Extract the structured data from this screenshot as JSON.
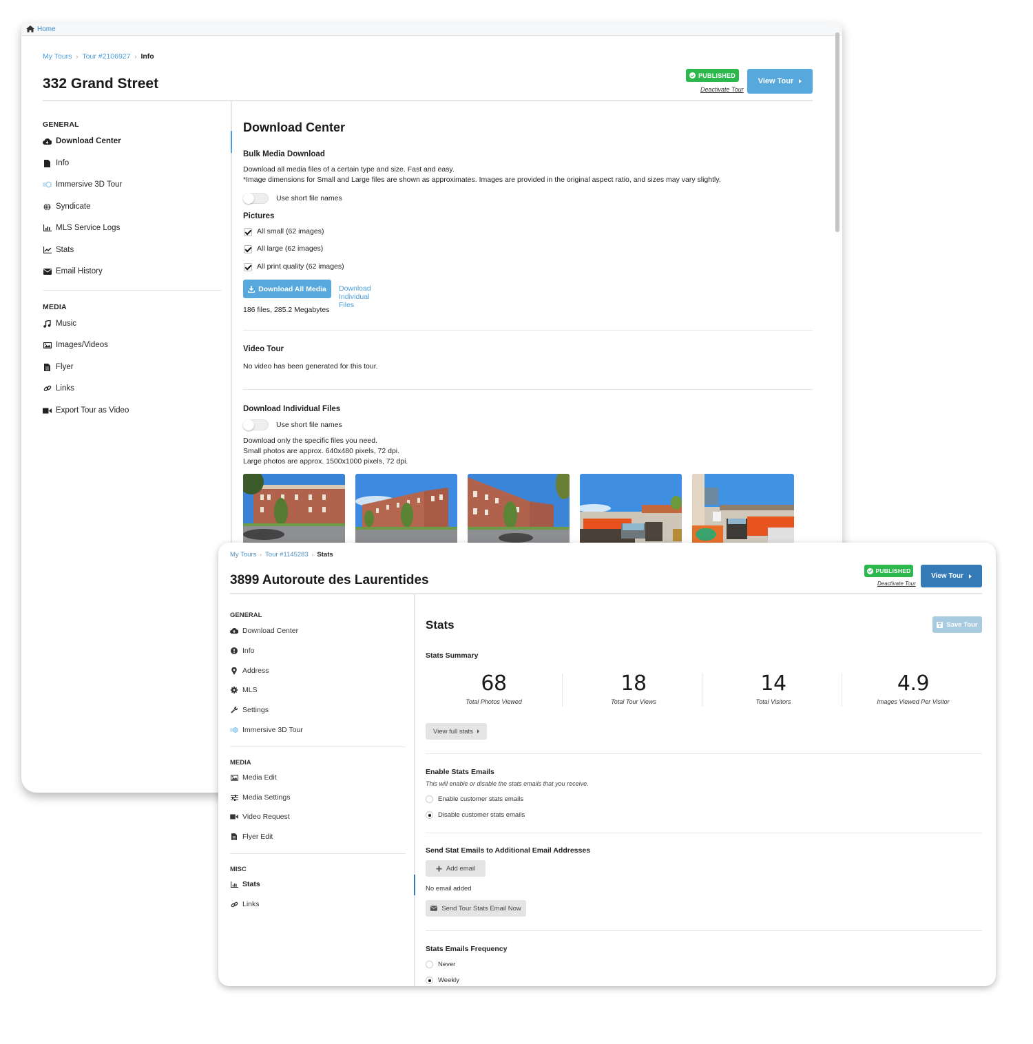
{
  "back_window": {
    "topbar": {
      "home_label": "Home"
    },
    "breadcrumb": {
      "items": [
        "My Tours",
        "Tour #2106927"
      ],
      "current": "Info"
    },
    "title": "332 Grand Street",
    "status_badge": "PUBLISHED",
    "deactivate_label": "Deactivate Tour",
    "view_tour_label": "View Tour",
    "sidebar": {
      "general_heading": "GENERAL",
      "general_items": [
        {
          "label": "Download Center",
          "icon": "cloud-download-icon",
          "active": true
        },
        {
          "label": "Info",
          "icon": "file-icon"
        },
        {
          "label": "Immersive 3D Tour",
          "icon": "3d-tour-icon"
        },
        {
          "label": "Syndicate",
          "icon": "globe-icon"
        },
        {
          "label": "MLS Service Logs",
          "icon": "bar-chart-icon"
        },
        {
          "label": "Stats",
          "icon": "line-chart-icon"
        },
        {
          "label": "Email History",
          "icon": "envelope-icon"
        }
      ],
      "media_heading": "MEDIA",
      "media_items": [
        {
          "label": "Music",
          "icon": "music-icon"
        },
        {
          "label": "Images/Videos",
          "icon": "image-icon"
        },
        {
          "label": "Flyer",
          "icon": "document-icon"
        },
        {
          "label": "Links",
          "icon": "link-icon"
        },
        {
          "label": "Export Tour as Video",
          "icon": "video-camera-icon"
        }
      ]
    },
    "main": {
      "heading": "Download Center",
      "bulk": {
        "heading": "Bulk Media Download",
        "desc1": "Download all media files of a certain type and size. Fast and easy.",
        "desc2": "*Image dimensions for Small and Large files are shown as approximates. Images are provided in the original aspect ratio, and sizes may vary slightly.",
        "toggle_label": "Use short file names",
        "toggle_on": false
      },
      "pictures": {
        "heading": "Pictures",
        "options": [
          {
            "label": "All small (62 images)",
            "checked": true
          },
          {
            "label": "All large (62 images)",
            "checked": true
          },
          {
            "label": "All print quality (62 images)",
            "checked": true
          }
        ],
        "download_all_label": "Download All Media",
        "download_individual_label": "Download Individual Files",
        "summary": "186 files, 285.2 Megabytes"
      },
      "video": {
        "heading": "Video Tour",
        "desc": "No video has been generated for this tour."
      },
      "individual": {
        "heading": "Download Individual Files",
        "toggle_label": "Use short file names",
        "toggle_on": false,
        "desc1": "Download only the specific files you need.",
        "desc2": "Small photos are approx. 640x480 pixels, 72 dpi.",
        "desc3": "Large photos are approx. 1500x1000 pixels, 72 dpi.",
        "thumbnails": [
          {
            "subject": "brick townhouses exterior"
          },
          {
            "subject": "brick townhouses corner view"
          },
          {
            "subject": "brick townhouses street view"
          },
          {
            "subject": "rooftop patio with orange sofa"
          },
          {
            "subject": "rooftop patio with fire table"
          }
        ]
      }
    }
  },
  "front_window": {
    "breadcrumb": {
      "items": [
        "My Tours",
        "Tour #1145283"
      ],
      "current": "Stats"
    },
    "title": "3899 Autoroute des Laurentides",
    "status_badge": "PUBLISHED",
    "deactivate_label": "Deactivate Tour",
    "view_tour_label": "View Tour",
    "sidebar": {
      "general_heading": "GENERAL",
      "general_items": [
        {
          "label": "Download Center",
          "icon": "cloud-download-icon"
        },
        {
          "label": "Info",
          "icon": "info-circle-icon"
        },
        {
          "label": "Address",
          "icon": "map-pin-icon"
        },
        {
          "label": "MLS",
          "icon": "gear-icon"
        },
        {
          "label": "Settings",
          "icon": "wrench-icon"
        },
        {
          "label": "Immersive 3D Tour",
          "icon": "3d-tour-icon"
        }
      ],
      "media_heading": "MEDIA",
      "media_items": [
        {
          "label": "Media Edit",
          "icon": "image-icon"
        },
        {
          "label": "Media Settings",
          "icon": "sliders-icon"
        },
        {
          "label": "Video Request",
          "icon": "video-camera-icon"
        },
        {
          "label": "Flyer Edit",
          "icon": "document-icon"
        }
      ],
      "misc_heading": "MISC",
      "misc_items": [
        {
          "label": "Stats",
          "icon": "bar-chart-icon",
          "active": true
        },
        {
          "label": "Links",
          "icon": "link-icon"
        }
      ]
    },
    "main": {
      "heading": "Stats",
      "save_label": "Save Tour",
      "summary_heading": "Stats Summary",
      "stats": [
        {
          "value": "68",
          "label": "Total Photos Viewed"
        },
        {
          "value": "18",
          "label": "Total Tour Views"
        },
        {
          "value": "14",
          "label": "Total Visitors"
        },
        {
          "value": "4.9",
          "label": "Images Viewed Per Visitor"
        }
      ],
      "view_full_stats_label": "View full stats",
      "enable_emails": {
        "heading": "Enable Stats Emails",
        "desc": "This will enable or disable the stats emails that you receive.",
        "options": [
          {
            "label": "Enable customer stats emails",
            "selected": false
          },
          {
            "label": "Disable customer stats emails",
            "selected": true
          }
        ]
      },
      "additional": {
        "heading": "Send Stat Emails to Additional Email Addresses",
        "add_label": "Add email",
        "empty_text": "No email added",
        "send_now_label": "Send Tour Stats Email Now"
      },
      "frequency": {
        "heading": "Stats Emails Frequency",
        "options": [
          {
            "label": "Never",
            "selected": false
          },
          {
            "label": "Weekly",
            "selected": true
          }
        ]
      }
    }
  },
  "colors": {
    "accent_blue": "#4a9edb",
    "published_green": "#2db84d",
    "view_tour_dark": "#337ab7",
    "save_disabled": "#a9cbe0"
  }
}
